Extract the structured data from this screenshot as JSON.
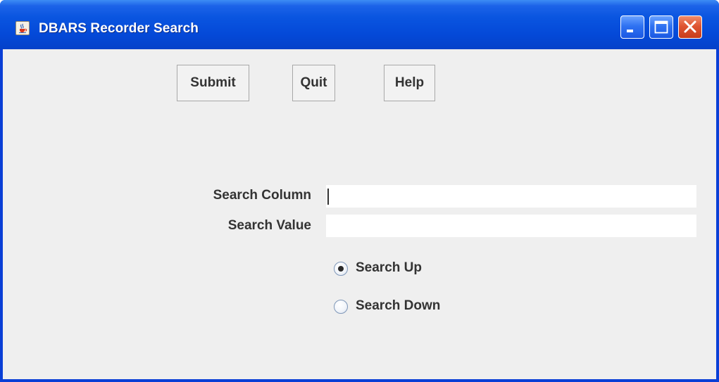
{
  "window": {
    "title": "DBARS Recorder Search"
  },
  "toolbar": {
    "submit_label": "Submit",
    "quit_label": "Quit",
    "help_label": "Help"
  },
  "form": {
    "search_column_label": "Search Column",
    "search_column_value": "",
    "search_value_label": "Search Value",
    "search_value_value": "",
    "radio_options": [
      {
        "label": "Search Up",
        "selected": true
      },
      {
        "label": "Search Down",
        "selected": false
      }
    ]
  },
  "icons": {
    "app": "java-cup-icon",
    "minimize": "minimize-icon",
    "maximize": "maximize-icon",
    "close": "close-icon"
  },
  "colors": {
    "titlebar": "#0449d8",
    "client_background": "#efefef",
    "close_button": "#df5532"
  }
}
